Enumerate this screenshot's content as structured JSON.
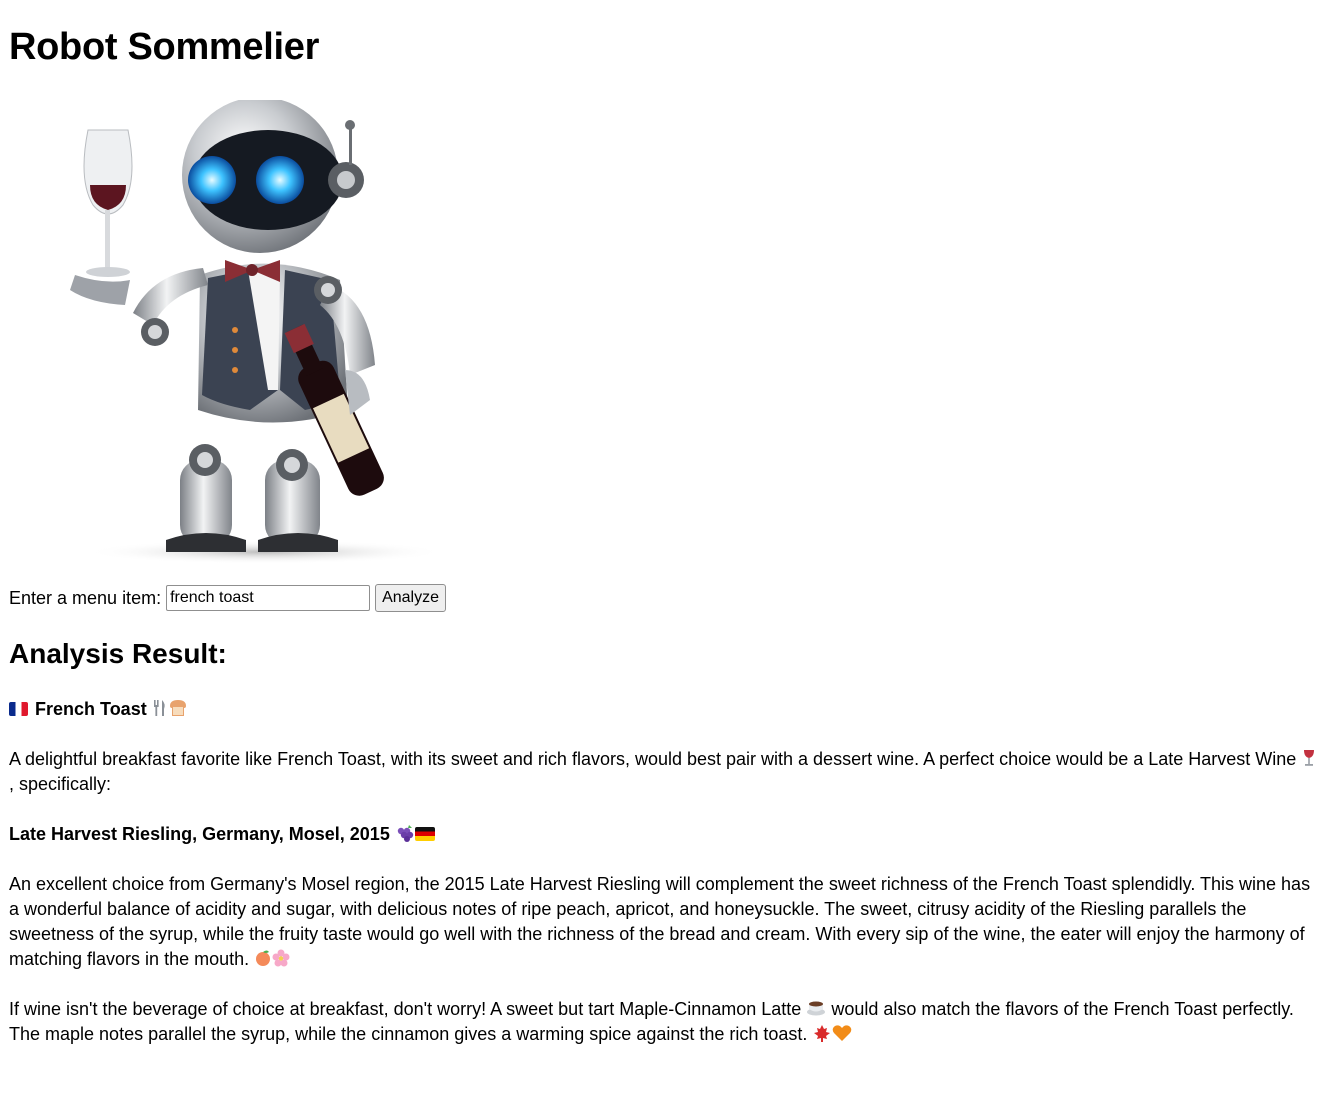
{
  "app": {
    "title": "Robot Sommelier"
  },
  "form": {
    "label": "Enter a menu item:",
    "input_value": "french toast",
    "button_label": "Analyze"
  },
  "result": {
    "heading": "Analysis Result:",
    "dish_title": "French Toast",
    "intro_text_1": "A delightful breakfast favorite like French Toast, with its sweet and rich flavors, would best pair with a dessert wine. A perfect choice would be a Late Harvest Wine",
    "intro_text_2": ", specifically:",
    "wine_title": "Late Harvest Riesling, Germany, Mosel, 2015",
    "wine_description": "An excellent choice from Germany's Mosel region, the 2015 Late Harvest Riesling will complement the sweet richness of the French Toast splendidly. This wine has a wonderful balance of acidity and sugar, with delicious notes of ripe peach, apricot, and honeysuckle. The sweet, citrusy acidity of the Riesling parallels the sweetness of the syrup, while the fruity taste would go well with the richness of the bread and cream. With every sip of the wine, the eater will enjoy the harmony of matching flavors in the mouth.",
    "alt_text_1": "If wine isn't the beverage of choice at breakfast, don't worry! A sweet but tart Maple-Cinnamon Latte",
    "alt_text_2": "would also match the flavors of the French Toast perfectly. The maple notes parallel the syrup, while the cinnamon gives a warming spice against the rich toast."
  },
  "icons": {
    "dish_title_prefix": "flag-france-icon",
    "dish_title_suffix": [
      "fork-knife-icon",
      "bread-icon"
    ],
    "intro_inline": "wine-glass-icon",
    "wine_title_suffix": [
      "grapes-icon",
      "flag-germany-icon"
    ],
    "description_suffix": [
      "peach-icon",
      "blossom-icon"
    ],
    "alt_inline": "coffee-icon",
    "alt_suffix": [
      "maple-leaf-icon",
      "orange-heart-icon"
    ]
  }
}
